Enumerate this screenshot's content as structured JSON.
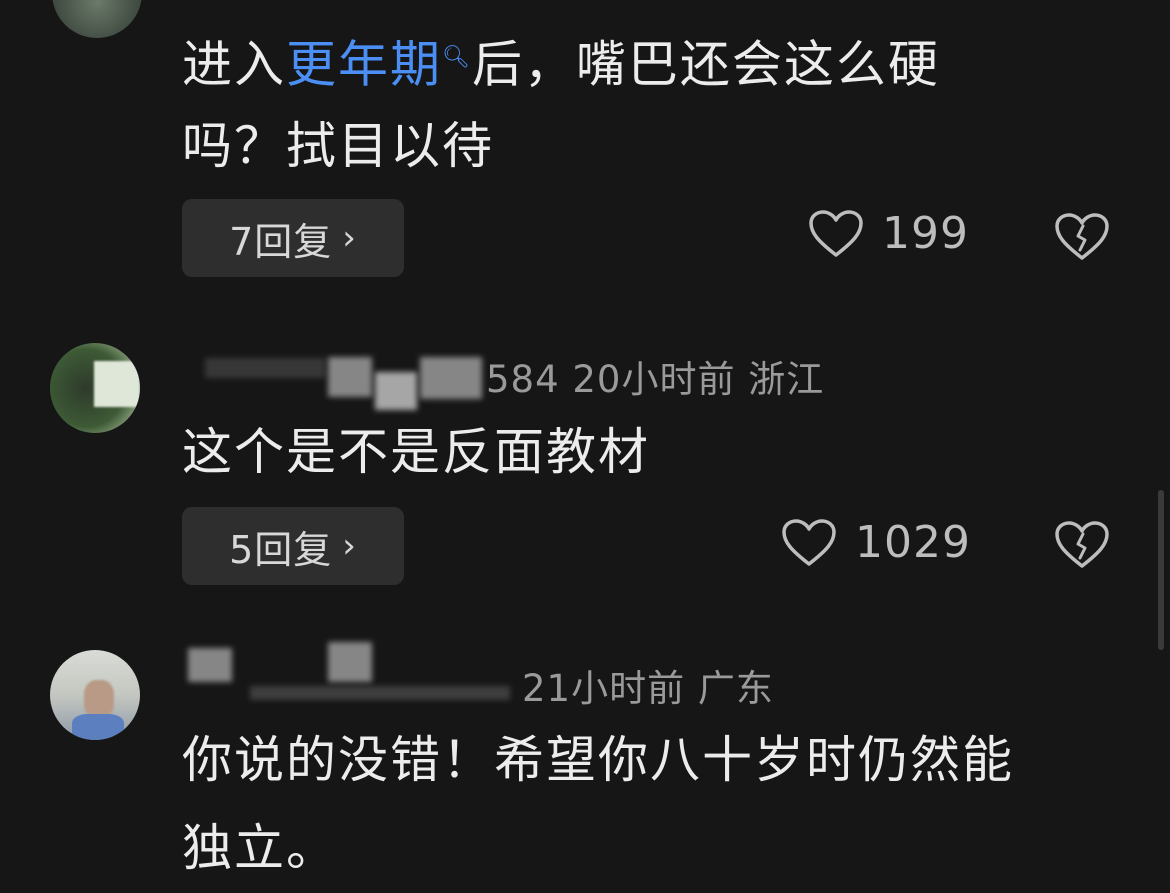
{
  "comments": [
    {
      "text_before": "进入",
      "link": "更年期",
      "text_after_line1": "后，嘴巴还会这么硬",
      "text_line2": "吗？拭目以待",
      "reply_label": "7回复",
      "likes": "199"
    },
    {
      "meta": "584  20小时前  浙江",
      "text_line1": "这个是不是反面教材",
      "reply_label": "5回复",
      "likes": "1029"
    },
    {
      "meta": "21小时前  广东",
      "text_line1": "你说的没错！希望你八十岁时仍然能",
      "text_line2": "独立。"
    }
  ],
  "icons": {
    "like": "heart-outline-icon",
    "dislike": "broken-heart-icon",
    "chevron": "chevron-right-icon",
    "search": "search-icon"
  },
  "colors": {
    "background": "#161616",
    "link": "#4b8ff5",
    "button": "#2e2e2e"
  }
}
